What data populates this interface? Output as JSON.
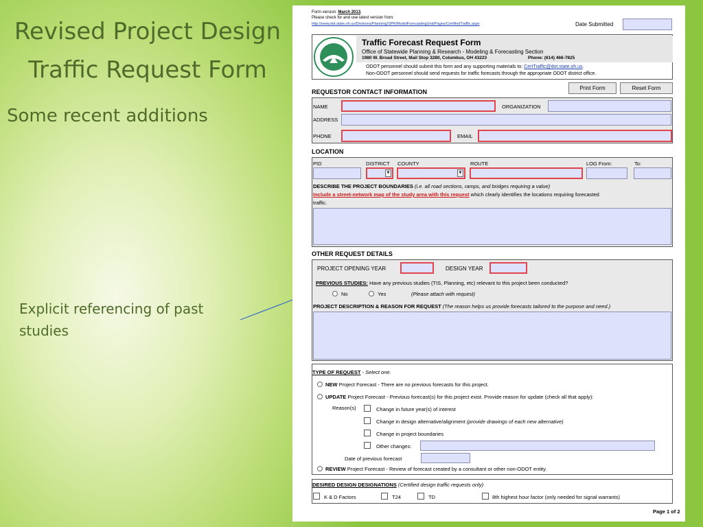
{
  "slide": {
    "title_line1": "Revised Project Design",
    "title_line2": "Traffic Request Form",
    "subtitle": "Some recent additions",
    "callout_line1": "Explicit referencing of past",
    "callout_line2": "studies"
  },
  "form": {
    "version_label": "Form version:",
    "version_value": "March 2013",
    "check_text": "Please check for and use latest version from:",
    "url": "http://www.dot.state.oh.us/Divisions/Planning/SPR/ModelForecastingUnit/Pages/CertifiedTraffic.aspx",
    "date_submitted_label": "Date Submitted",
    "title": "Traffic Forecast Request Form",
    "office": "Office of Statewide Planning & Research - Modeling & Forecasting Section",
    "address": "1980 W. Broad Street, Mail Stop 3280, Columbus, OH 43223",
    "phone": "Phone: (614) 466-7825",
    "odot_note": "ODOT personnel should submit this form and any supporting materials to:",
    "odot_email": "CertTraffic@dot.state.oh.us",
    "nonodot_note": "Non-ODOT personnel should send requests for traffic forecasts through the appropriate ODOT district office.",
    "seal_top": "STATE OF OHIO",
    "seal_bottom": "DEPARTMENT OF TRANSPORTATION",
    "print_button": "Print Form",
    "reset_button": "Reset Form",
    "requestor_header": "REQUESTOR CONTACT INFORMATION",
    "name_label": "NAME",
    "organization_label": "ORGANIZATION",
    "address_label": "ADDRESS",
    "phone_label": "PHONE",
    "email_label": "EMAIL",
    "location_header": "LOCATION",
    "pid_label": "PID",
    "district_label": "DISTRICT",
    "county_label": "COUNTY",
    "route_label": "ROUTE",
    "log_from_label": "LOG From:",
    "to_label": "To:",
    "boundaries_bold": "DESCRIBE THE PROJECT BOUNDARIES",
    "boundaries_italic": "(i.e. all road sections, ramps, and bridges requiring a value)",
    "map_link": "Include a street-network map of the study area with this request",
    "map_rest": "which clearly identifies the locations requiring forecasted",
    "map_rest2": "traffic.",
    "other_header": "OTHER REQUEST DETAILS",
    "opening_year_label": "PROJECT OPENING YEAR",
    "design_year_label": "DESIGN YEAR",
    "prev_studies_label": "PREVIOUS STUDIES:",
    "prev_studies_question": "Have any previous studies (TIS, Planning, etc) relevant to this project been conducted?",
    "no_label": "No",
    "yes_label": "Yes",
    "attach_note": "(Please attach with request)",
    "desc_bold": "PROJECT DESCRIPTION & REASON FOR REQUEST",
    "desc_italic": "(The reason helps us provide forecasts tailored to the purpose and need.)",
    "type_header": "TYPE OF REQUEST",
    "type_select": "- Select one.",
    "new_bold": "NEW",
    "new_text": "Project Forecast - There are no previous forecasts for this project.",
    "update_bold": "UPDATE",
    "update_text": "Project Forecast - Previous forecast(s) for this project exist. Provide reason for update (check all that apply):",
    "reasons_label": "Reason(s)",
    "reason1": "Change in future year(s) of interest",
    "reason2": "Change in design alternative/alignment",
    "reason2_italic": "(provide drawings of each new alternative)",
    "reason3": "Change in project boundaries",
    "reason4": "Other changes:",
    "prev_forecast_date": "Date of previous forecast",
    "review_bold": "REVIEW",
    "review_text": "Project Forecast - Review of forecast created by a consultant or other non-ODOT entity.",
    "designations_header": "DESIRED DESIGN DESIGNATIONS",
    "designations_note": "(Certified design traffic requests only)",
    "kd_label": "K & D Factors",
    "t24_label": "T24",
    "td_label": "TD",
    "eighth_label": "8th highest hour factor (only needed for signal warrants)",
    "page_label": "Page 1 of 2"
  },
  "colors": {
    "slide_text": "#4f6b2a",
    "field_fill": "#dde1fb",
    "required_border": "#e0444a",
    "arrow": "#3a6cc8"
  }
}
